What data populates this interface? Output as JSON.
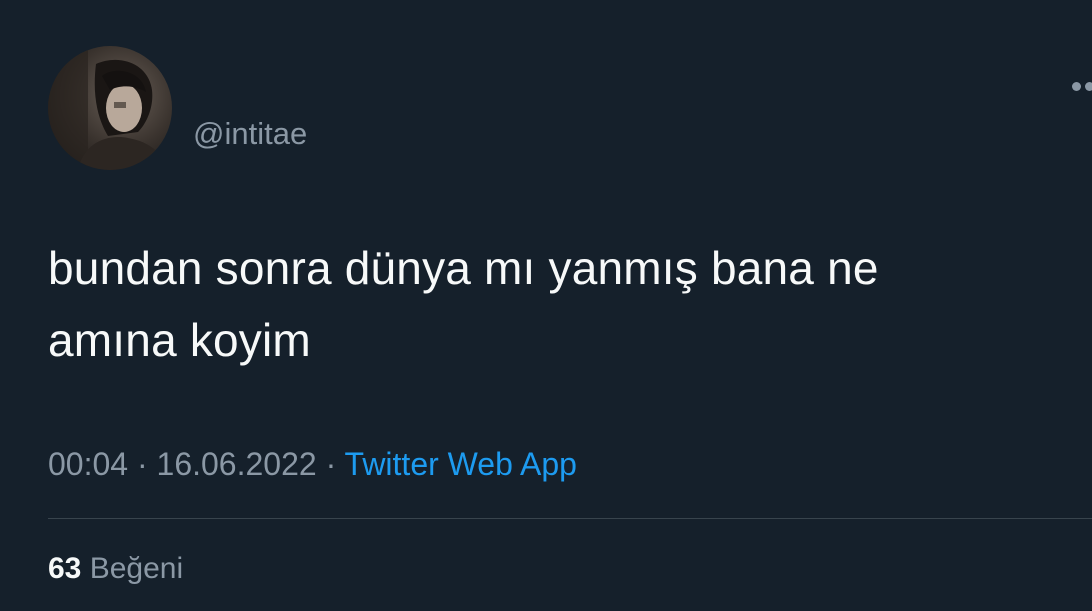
{
  "tweet": {
    "handle": "@intitae",
    "avatar": "profile-photo",
    "text_line1": "bundan sonra dünya mı yanmış bana ne",
    "text_line2": "amına koyim",
    "time": "00:04",
    "separator1": " · ",
    "date": "16.06.2022",
    "separator2": " · ",
    "source": "Twitter Web App",
    "likes_count": "63",
    "likes_label": "Beğeni",
    "more_icon": "more-dots-icon"
  },
  "colors": {
    "background": "#15202b",
    "text_primary": "#f7f9f9",
    "text_secondary": "#8b98a5",
    "link": "#1d9bf0",
    "divider": "#38444d"
  }
}
